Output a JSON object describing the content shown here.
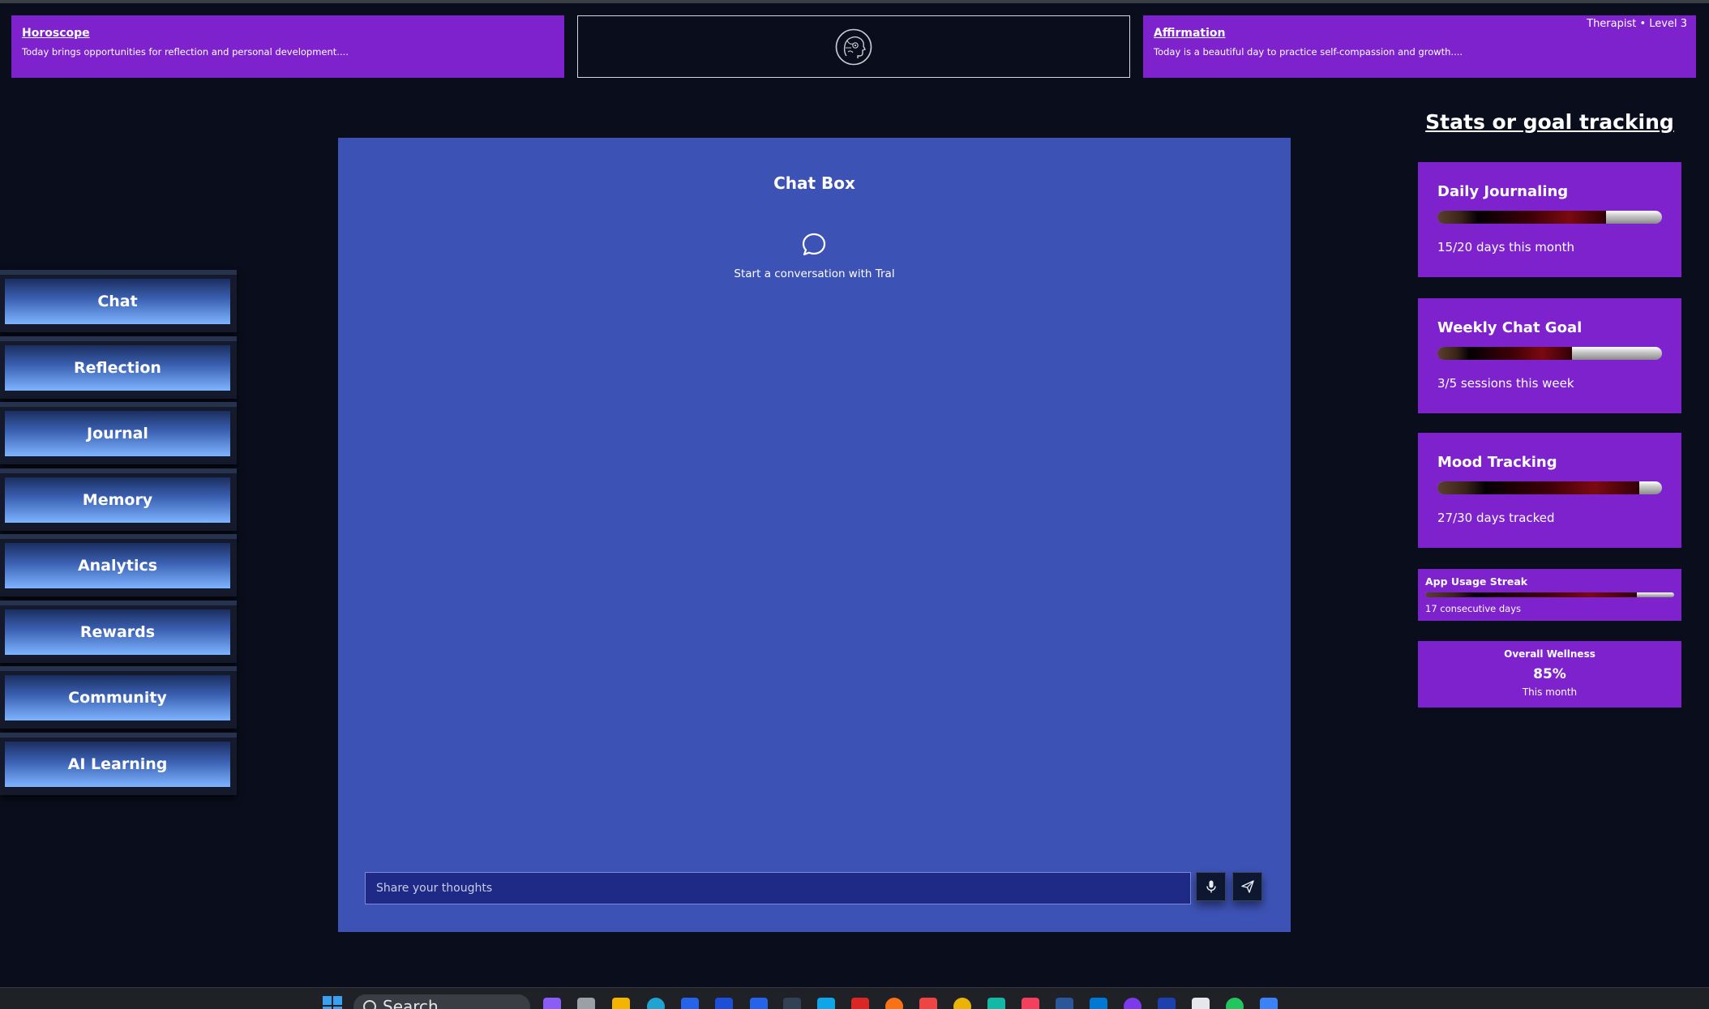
{
  "header": {
    "horoscope": {
      "title": "Horoscope",
      "text": "Today brings opportunities for reflection and personal development...."
    },
    "affirmation": {
      "title": "Affirmation",
      "text": "Today is a beautiful day to practice self-compassion and growth...."
    },
    "level_label": "Therapist • Level 3"
  },
  "sidebar": {
    "items": [
      {
        "label": "Chat"
      },
      {
        "label": "Reflection"
      },
      {
        "label": "Journal"
      },
      {
        "label": "Memory"
      },
      {
        "label": "Analytics"
      },
      {
        "label": "Rewards"
      },
      {
        "label": "Community"
      },
      {
        "label": "AI Learning"
      }
    ]
  },
  "chat": {
    "title": "Chat Box",
    "empty_state": "Start a conversation with Tral",
    "input_placeholder": "Share your thoughts"
  },
  "stats": {
    "heading": "Stats or goal tracking",
    "cards": [
      {
        "title": "Daily Journaling",
        "progress": 0.75,
        "subtitle": "15/20 days this month"
      },
      {
        "title": "Weekly Chat Goal",
        "progress": 0.6,
        "subtitle": "3/5 sessions this week"
      },
      {
        "title": "Mood Tracking",
        "progress": 0.9,
        "subtitle": "27/30 days tracked"
      }
    ],
    "streak": {
      "title": "App Usage Streak",
      "progress": 0.85,
      "subtitle": "17 consecutive days"
    },
    "wellness": {
      "title": "Overall Wellness",
      "value": "85%",
      "subtitle": "This month"
    }
  },
  "taskbar": {
    "search_label": "Search"
  },
  "colors": {
    "background": "#0a0e1c",
    "banner": "#7e22ce",
    "chat_panel": "#3d52b5",
    "chat_input": "#1e2a86",
    "nav_gradient_top": "#1b2e60",
    "nav_gradient_bottom": "#7eb4ff"
  }
}
